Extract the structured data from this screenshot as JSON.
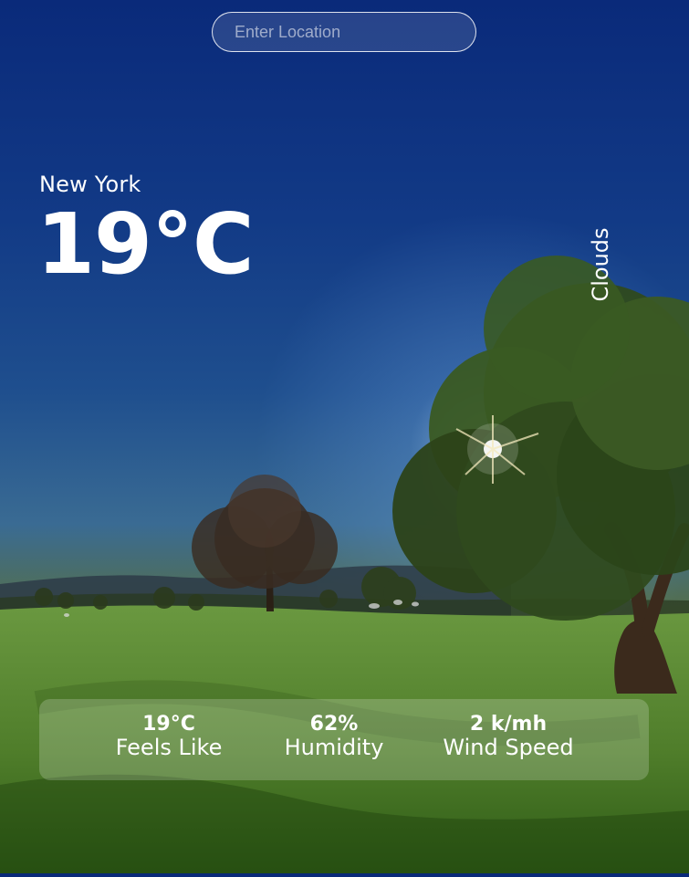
{
  "search": {
    "placeholder": "Enter Location"
  },
  "weather": {
    "city": "New York",
    "temperature": "19°C",
    "condition": "Clouds"
  },
  "stats": {
    "feels_like": {
      "value": "19°C",
      "label": "Feels Like"
    },
    "humidity": {
      "value": "62%",
      "label": "Humidity"
    },
    "wind_speed": {
      "value": "2 k/mh",
      "label": "Wind Speed"
    }
  }
}
